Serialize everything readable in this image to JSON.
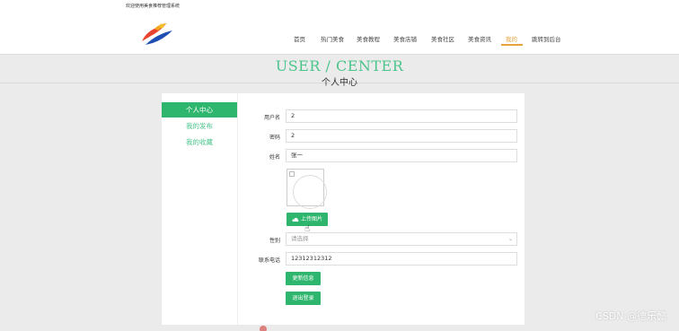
{
  "header": {
    "welcome": "欢迎使用美食推荐管理系统",
    "logo_icon": "app-logo-icon",
    "nav": [
      {
        "label": "首页"
      },
      {
        "label": "热门美食"
      },
      {
        "label": "美食教程"
      },
      {
        "label": "美食店铺"
      },
      {
        "label": "美食社区"
      },
      {
        "label": "美食资讯"
      },
      {
        "label": "我的"
      },
      {
        "label": "跳转到后台"
      }
    ],
    "active_nav": "我的",
    "active_color": "#e6a23c"
  },
  "hero": {
    "title": "USER / CENTER",
    "subtitle": "个人中心",
    "accent": "#4cc48b"
  },
  "sidebar": {
    "items": [
      {
        "label": "个人中心"
      },
      {
        "label": "我的发布"
      },
      {
        "label": "我的收藏"
      }
    ]
  },
  "form": {
    "username": {
      "label": "用户名",
      "value": "2"
    },
    "password": {
      "label": "密码",
      "value": "2"
    },
    "name": {
      "label": "姓名",
      "value": "张一"
    },
    "upload_label": "上传图片",
    "gender": {
      "label": "性别",
      "placeholder": "请选择"
    },
    "phone": {
      "label": "联系电话",
      "value": "12312312312"
    },
    "update_button": "更新信息",
    "logout_button": "退出登录",
    "button_color": "#2fb66e"
  },
  "watermark": "CSDN @德乐懿"
}
